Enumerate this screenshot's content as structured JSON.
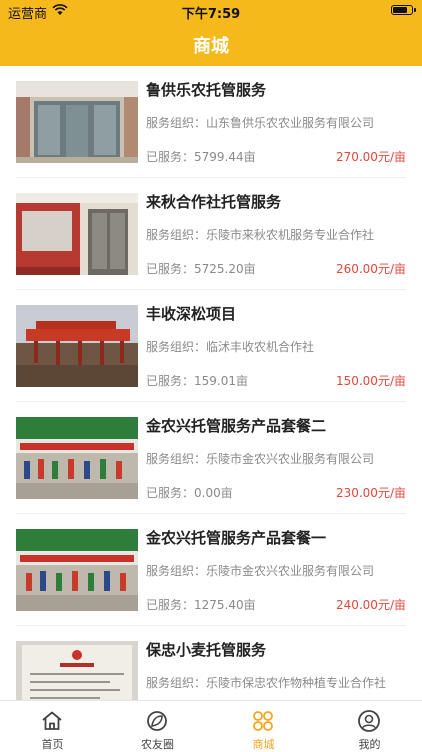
{
  "status_bar": {
    "carrier": "运营商",
    "time": "下午7:59",
    "battery_level": 0.85
  },
  "nav": {
    "title": "商城"
  },
  "colors": {
    "brand": "#f5b91c",
    "price": "#e2473a",
    "tab_active": "#f5a51c"
  },
  "items": [
    {
      "name": "鲁供乐农托管服务",
      "org_label": "服务组织：",
      "org": "山东鲁供乐农农业服务有限公司",
      "served_label": "已服务：",
      "served": "5799.44亩",
      "price": "270.00元/亩",
      "image": "shop-door-photo"
    },
    {
      "name": "来秋合作社托管服务",
      "org_label": "服务组织：",
      "org": "乐陵市来秋农机服务专业合作社",
      "served_label": "已服务：",
      "served": "5725.20亩",
      "price": "260.00元/亩",
      "image": "cooperative-door-photo"
    },
    {
      "name": "丰收深松项目",
      "org_label": "服务组织：",
      "org": "临沭丰收农机合作社",
      "served_label": "已服务：",
      "served": "159.01亩",
      "price": "150.00元/亩",
      "image": "farm-machinery-photo"
    },
    {
      "name": "金农兴托管服务产品套餐二",
      "org_label": "服务组织：",
      "org": "乐陵市金农兴农业服务有限公司",
      "served_label": "已服务：",
      "served": "0.00亩",
      "price": "230.00元/亩",
      "image": "storefront-banner-photo"
    },
    {
      "name": "金农兴托管服务产品套餐一",
      "org_label": "服务组织：",
      "org": "乐陵市金农兴农业服务有限公司",
      "served_label": "已服务：",
      "served": "1275.40亩",
      "price": "240.00元/亩",
      "image": "storefront-banner-photo"
    },
    {
      "name": "保忠小麦托管服务",
      "org_label": "服务组织：",
      "org": "乐陵市保忠农作物种植专业合作社",
      "served_label": "已服务：",
      "served": "",
      "price": "",
      "image": "business-license-photo"
    }
  ],
  "tabs": [
    {
      "label": "首页",
      "icon": "home-icon",
      "active": false
    },
    {
      "label": "农友圈",
      "icon": "leaf-icon",
      "active": false
    },
    {
      "label": "商城",
      "icon": "mall-grid-icon",
      "active": true
    },
    {
      "label": "我的",
      "icon": "profile-icon",
      "active": false
    }
  ]
}
